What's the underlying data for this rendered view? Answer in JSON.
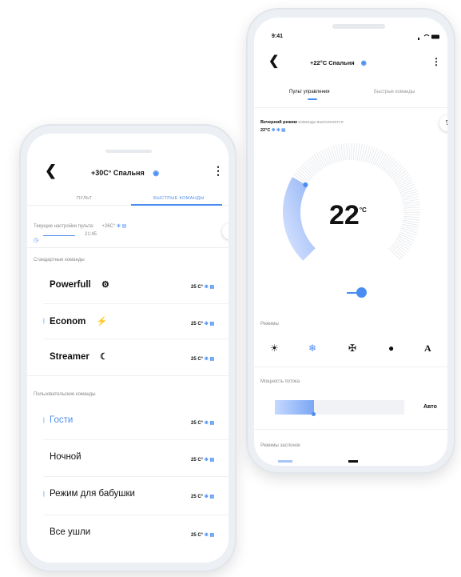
{
  "front_phone": {
    "title": "+30C° Спальня",
    "tabs": [
      "ПУЛЬТ",
      "БЫСТРЫЕ КОМАНДЫ"
    ],
    "current_settings_label": "Текущие настройки пульта:",
    "current_settings_value": "+26C°",
    "timer_value": "21:45",
    "help_label": "?",
    "standard_section": "Стандартные команды",
    "standard_commands": [
      {
        "name": "Powerfull",
        "temp": "25 C°"
      },
      {
        "name": "Econom",
        "temp": "25 C°"
      },
      {
        "name": "Streamer",
        "temp": "25 C°"
      }
    ],
    "user_section": "Пользовательские команды",
    "user_commands": [
      {
        "name": "Гости",
        "temp": "25 C°"
      },
      {
        "name": "Ночной",
        "temp": "25 C°"
      },
      {
        "name": "Режим для бабушки",
        "temp": "25 C°"
      },
      {
        "name": "Все ушли",
        "temp": "25 C°"
      }
    ]
  },
  "back_phone": {
    "time": "9:41",
    "title": "+22°C Спальня",
    "tabs": [
      "Пульт управления",
      "Быстрые команды"
    ],
    "evening_mode_title": "Вечерний режим",
    "evening_mode_status": "команда выполняется",
    "evening_mode_temp": "22°C",
    "help_label": "?",
    "dial_value": "22",
    "dial_unit": "°C",
    "dial_fill_fraction": 0.28,
    "modes_label": "Режимы",
    "modes": [
      "sun-icon",
      "snowflake-icon",
      "fan-icon",
      "drop-icon",
      "auto-icon"
    ],
    "mode_auto_label": "A",
    "flow_label": "Мощность потока",
    "flow_value_label": "Авто",
    "flow_fill_fraction": 0.3,
    "damper_label": "Режимы заслонок"
  },
  "colors": {
    "accent": "#4a8df0",
    "accent_light": "#c5d9ff"
  }
}
